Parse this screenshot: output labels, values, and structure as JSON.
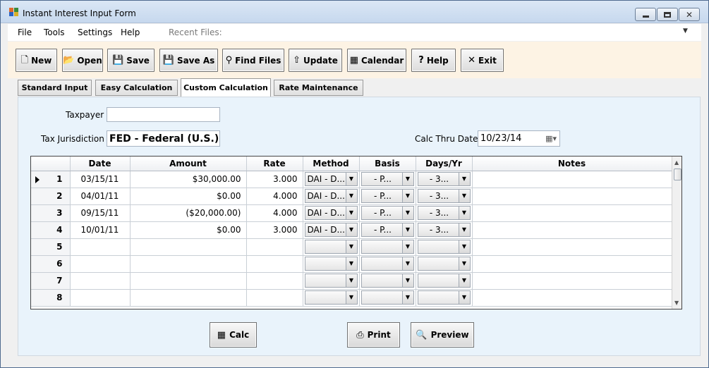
{
  "window": {
    "title": "Instant Interest Input Form"
  },
  "menu": {
    "items": [
      "File",
      "Tools",
      "Settings",
      "Help"
    ],
    "recent_label": "Recent Files:"
  },
  "toolbar": {
    "new": "New",
    "open": "Open",
    "save": "Save",
    "save_as": "Save As",
    "find_files": "Find Files",
    "update": "Update",
    "calendar": "Calendar",
    "help": "Help",
    "exit": "Exit"
  },
  "tabs": [
    "Standard Input",
    "Easy Calculation",
    "Custom Calculation",
    "Rate Maintenance"
  ],
  "active_tab": "Custom Calculation",
  "form": {
    "taxpayer_label": "Taxpayer",
    "taxpayer_value": "",
    "jurisdiction_label": "Tax Jurisdiction",
    "jurisdiction_value": "FED - Federal (U.S.)",
    "calc_thru_label": "Calc Thru Date",
    "calc_thru_value": "10/23/14"
  },
  "grid": {
    "columns": [
      "",
      "Date",
      "Amount",
      "Rate",
      "Method",
      "Basis",
      "Days/Yr",
      "Notes"
    ],
    "rows": [
      {
        "num": "1",
        "date": "03/15/11",
        "amount": "$30,000.00",
        "rate": "3.000",
        "method": "DAI - D...",
        "basis": "- P...",
        "days": "- 3...",
        "notes": "",
        "current": true
      },
      {
        "num": "2",
        "date": "04/01/11",
        "amount": "$0.00",
        "rate": "4.000",
        "method": "DAI - D...",
        "basis": "- P...",
        "days": "- 3...",
        "notes": ""
      },
      {
        "num": "3",
        "date": "09/15/11",
        "amount": "($20,000.00)",
        "rate": "4.000",
        "method": "DAI - D...",
        "basis": "- P...",
        "days": "- 3...",
        "notes": ""
      },
      {
        "num": "4",
        "date": "10/01/11",
        "amount": "$0.00",
        "rate": "3.000",
        "method": "DAI - D...",
        "basis": "- P...",
        "days": "- 3...",
        "notes": ""
      },
      {
        "num": "5",
        "date": "",
        "amount": "",
        "rate": "",
        "method": "",
        "basis": "",
        "days": "",
        "notes": ""
      },
      {
        "num": "6",
        "date": "",
        "amount": "",
        "rate": "",
        "method": "",
        "basis": "",
        "days": "",
        "notes": ""
      },
      {
        "num": "7",
        "date": "",
        "amount": "",
        "rate": "",
        "method": "",
        "basis": "",
        "days": "",
        "notes": ""
      },
      {
        "num": "8",
        "date": "",
        "amount": "",
        "rate": "",
        "method": "",
        "basis": "",
        "days": "",
        "notes": ""
      }
    ]
  },
  "actions": {
    "calc": "Calc",
    "print": "Print",
    "preview": "Preview"
  },
  "icons": {
    "new": "new-document-icon",
    "open": "open-folder-icon",
    "save": "save-icon",
    "save_as": "save-as-icon",
    "find_files": "binoculars-icon",
    "update": "update-icon",
    "calendar": "calendar-icon",
    "help": "help-icon",
    "exit": "exit-icon",
    "calc": "calculator-icon",
    "print": "printer-icon",
    "preview": "preview-icon"
  },
  "colors": {
    "toolbar_bg": "#fdf3e4",
    "panel_bg": "#e9f3fb"
  }
}
